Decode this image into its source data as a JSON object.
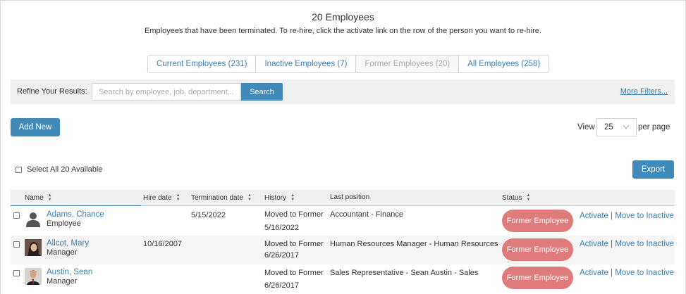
{
  "header": {
    "title": "20 Employees",
    "subtitle": "Employees that have been terminated. To re-hire, click the activate link on the row of the person you want to re-hire."
  },
  "tabs": [
    {
      "label": "Current Employees (231)",
      "active": false
    },
    {
      "label": "Inactive Employees (7)",
      "active": false
    },
    {
      "label": "Former Employees (20)",
      "active": true
    },
    {
      "label": "All Employees (258)",
      "active": false
    }
  ],
  "filter": {
    "label": "Refine Your Results:",
    "placeholder": "Search by employee, job, department,...",
    "search_label": "Search",
    "more_filters": "More Filters..."
  },
  "toolbar": {
    "add_new": "Add New",
    "view_label": "View",
    "page_size": "25",
    "per_page": "per page",
    "select_all": "Select All 20 Available",
    "export": "Export"
  },
  "columns": {
    "name": "Name",
    "hire_date": "Hire date",
    "termination_date": "Termination date",
    "history": "History",
    "last_position": "Last position",
    "status": "Status"
  },
  "rows": [
    {
      "name": "Adams, Chance",
      "role": "Employee",
      "hire_date": "",
      "termination_date": "5/15/2022",
      "history_line1": "Moved to Former",
      "history_line2": "5/16/2022",
      "last_position": "Accountant - Finance",
      "status": "Former Employee",
      "activate": "Activate",
      "separator": "|",
      "move": "Move to Inactive",
      "avatar": "person-silhouette-icon"
    },
    {
      "name": "Allcot, Mary",
      "role": "Manager",
      "hire_date": "10/16/2007",
      "termination_date": "",
      "history_line1": "Moved to Former",
      "history_line2": "6/26/2017",
      "last_position": "Human Resources Manager - Human Resources",
      "status": "Former Employee",
      "activate": "Activate",
      "separator": "|",
      "move": "Move to Inactive",
      "avatar": "photo"
    },
    {
      "name": "Austin, Sean",
      "role": "Manager",
      "hire_date": "",
      "termination_date": "",
      "history_line1": "Moved to Former",
      "history_line2": "6/26/2017",
      "last_position": "Sales Representative - Sean Austin - Sales",
      "status": "Former Employee",
      "activate": "Activate",
      "separator": "|",
      "move": "Move to Inactive",
      "avatar": "photo"
    }
  ],
  "colors": {
    "accent": "#3f8ab8",
    "link": "#3b7fb0",
    "status_former": "#e07b7b"
  }
}
